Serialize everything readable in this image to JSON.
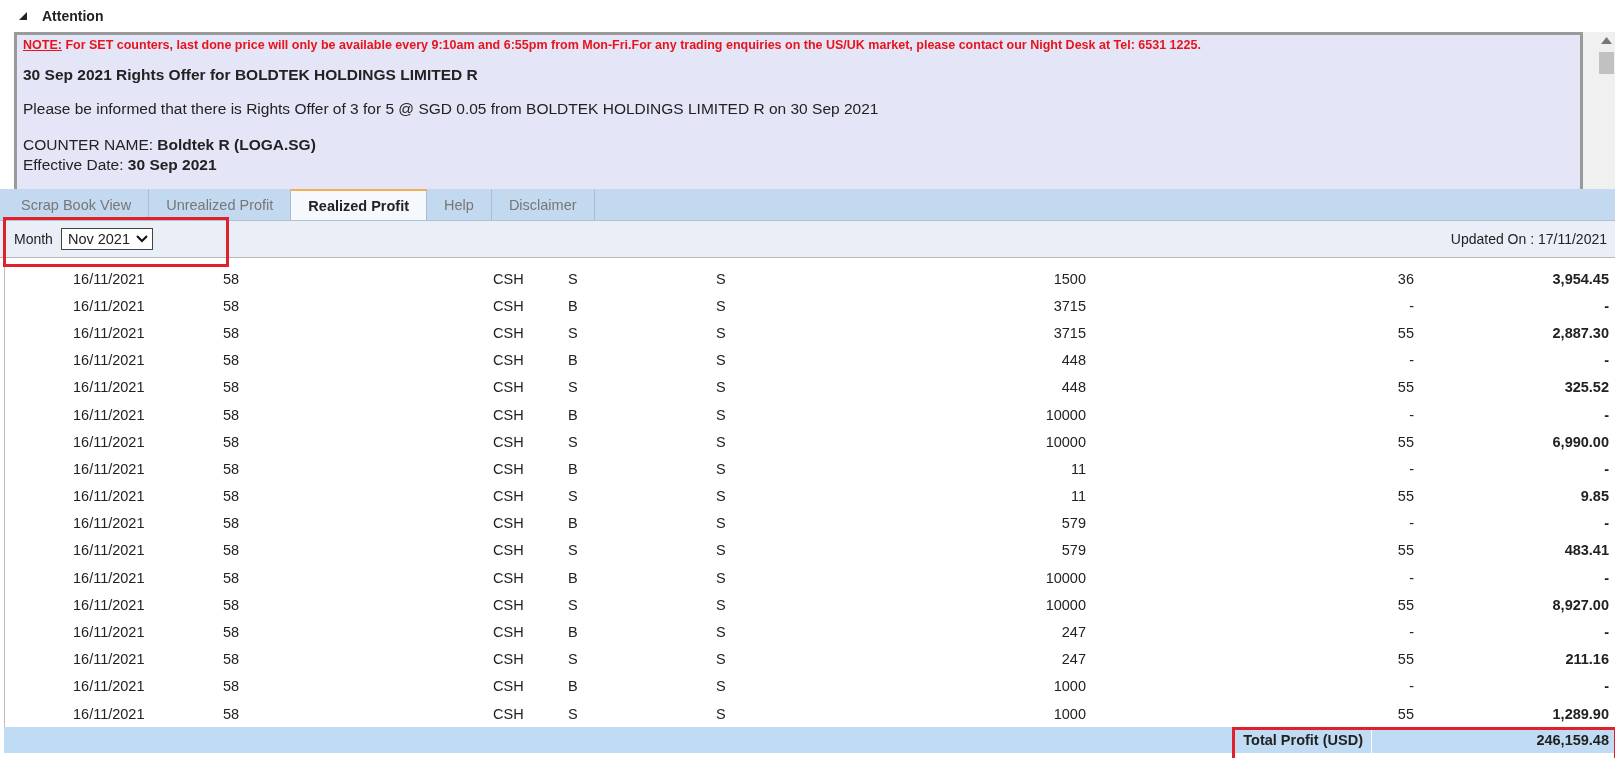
{
  "attention": {
    "title": "Attention",
    "expanded": true
  },
  "notice": {
    "note_label": "NOTE:",
    "note_text": "For SET counters, last done price will only be available every 9:10am and 6:55pm from Mon-Fri.For any trading enquiries on the US/UK market, please contact our Night Desk at Tel: 6531 1225.",
    "heading": "30 Sep 2021 Rights Offer for BOLDTEK HOLDINGS LIMITED R",
    "body": "Please be informed that there is Rights Offer of 3 for 5 @ SGD 0.05 from BOLDTEK HOLDINGS LIMITED R on 30 Sep 2021",
    "counter_label": "COUNTER NAME:",
    "counter_value": "Boldtek R (LOGA.SG)",
    "date_label": "Effective Date:",
    "date_value": "30 Sep 2021"
  },
  "tabs": [
    {
      "label": "Scrap Book View",
      "selected": false
    },
    {
      "label": "Unrealized Profit",
      "selected": false
    },
    {
      "label": "Realized Profit",
      "selected": true
    },
    {
      "label": "Help",
      "selected": false
    },
    {
      "label": "Disclaimer",
      "selected": false
    }
  ],
  "filter": {
    "month_label": "Month",
    "month_value": "Nov 2021",
    "updated": "Updated On : 17/11/2021"
  },
  "rows": [
    {
      "date": "16/11/2021",
      "ref": "58",
      "account": "CSH",
      "side": "S",
      "exchange": "S",
      "qty": "1500",
      "fee": "36",
      "profit": "3,954.45"
    },
    {
      "date": "16/11/2021",
      "ref": "58",
      "account": "CSH",
      "side": "B",
      "exchange": "S",
      "qty": "3715",
      "fee": "-",
      "profit": "-"
    },
    {
      "date": "16/11/2021",
      "ref": "58",
      "account": "CSH",
      "side": "S",
      "exchange": "S",
      "qty": "3715",
      "fee": "55",
      "profit": "2,887.30"
    },
    {
      "date": "16/11/2021",
      "ref": "58",
      "account": "CSH",
      "side": "B",
      "exchange": "S",
      "qty": "448",
      "fee": "-",
      "profit": "-"
    },
    {
      "date": "16/11/2021",
      "ref": "58",
      "account": "CSH",
      "side": "S",
      "exchange": "S",
      "qty": "448",
      "fee": "55",
      "profit": "325.52"
    },
    {
      "date": "16/11/2021",
      "ref": "58",
      "account": "CSH",
      "side": "B",
      "exchange": "S",
      "qty": "10000",
      "fee": "-",
      "profit": "-"
    },
    {
      "date": "16/11/2021",
      "ref": "58",
      "account": "CSH",
      "side": "S",
      "exchange": "S",
      "qty": "10000",
      "fee": "55",
      "profit": "6,990.00"
    },
    {
      "date": "16/11/2021",
      "ref": "58",
      "account": "CSH",
      "side": "B",
      "exchange": "S",
      "qty": "11",
      "fee": "-",
      "profit": "-"
    },
    {
      "date": "16/11/2021",
      "ref": "58",
      "account": "CSH",
      "side": "S",
      "exchange": "S",
      "qty": "11",
      "fee": "55",
      "profit": "9.85"
    },
    {
      "date": "16/11/2021",
      "ref": "58",
      "account": "CSH",
      "side": "B",
      "exchange": "S",
      "qty": "579",
      "fee": "-",
      "profit": "-"
    },
    {
      "date": "16/11/2021",
      "ref": "58",
      "account": "CSH",
      "side": "S",
      "exchange": "S",
      "qty": "579",
      "fee": "55",
      "profit": "483.41"
    },
    {
      "date": "16/11/2021",
      "ref": "58",
      "account": "CSH",
      "side": "B",
      "exchange": "S",
      "qty": "10000",
      "fee": "-",
      "profit": "-"
    },
    {
      "date": "16/11/2021",
      "ref": "58",
      "account": "CSH",
      "side": "S",
      "exchange": "S",
      "qty": "10000",
      "fee": "55",
      "profit": "8,927.00"
    },
    {
      "date": "16/11/2021",
      "ref": "58",
      "account": "CSH",
      "side": "B",
      "exchange": "S",
      "qty": "247",
      "fee": "-",
      "profit": "-"
    },
    {
      "date": "16/11/2021",
      "ref": "58",
      "account": "CSH",
      "side": "S",
      "exchange": "S",
      "qty": "247",
      "fee": "55",
      "profit": "211.16"
    },
    {
      "date": "16/11/2021",
      "ref": "58",
      "account": "CSH",
      "side": "B",
      "exchange": "S",
      "qty": "1000",
      "fee": "-",
      "profit": "-"
    },
    {
      "date": "16/11/2021",
      "ref": "58",
      "account": "CSH",
      "side": "S",
      "exchange": "S",
      "qty": "1000",
      "fee": "55",
      "profit": "1,289.90"
    }
  ],
  "total": {
    "label": "Total Profit (USD)",
    "value": "246,159.48"
  }
}
